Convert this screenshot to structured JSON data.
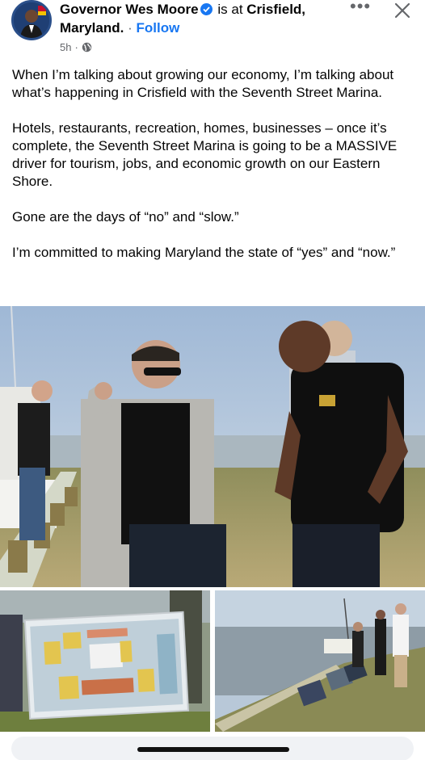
{
  "header": {
    "author_name": "Governor Wes Moore",
    "is_at": "is at",
    "place": "Crisfield, Maryland.",
    "separator": "·",
    "follow_label": "Follow",
    "time": "5h",
    "separator2": "·",
    "privacy_icon": "globe-icon",
    "more_icon": "more-dots-icon",
    "more_label": "•••",
    "close_icon": "close-icon"
  },
  "post": {
    "paragraphs": [
      "When I’m talking about growing our economy, I’m talking about what’s happening in Crisfield with the Seventh Street Marina.",
      "Hotels, restaurants, recreation, homes, businesses – once it’s complete, the Seventh Street Marina is going to be a MASSIVE driver for tourism, jobs, and economic growth on our Eastern Shore.",
      "Gone are the days of “no” and “slow.”",
      "I’m committed to making Maryland the state of “yes” and “now.”"
    ]
  },
  "colors": {
    "accent": "#1877f2",
    "secondary_text": "#65676b",
    "text": "#050505"
  }
}
